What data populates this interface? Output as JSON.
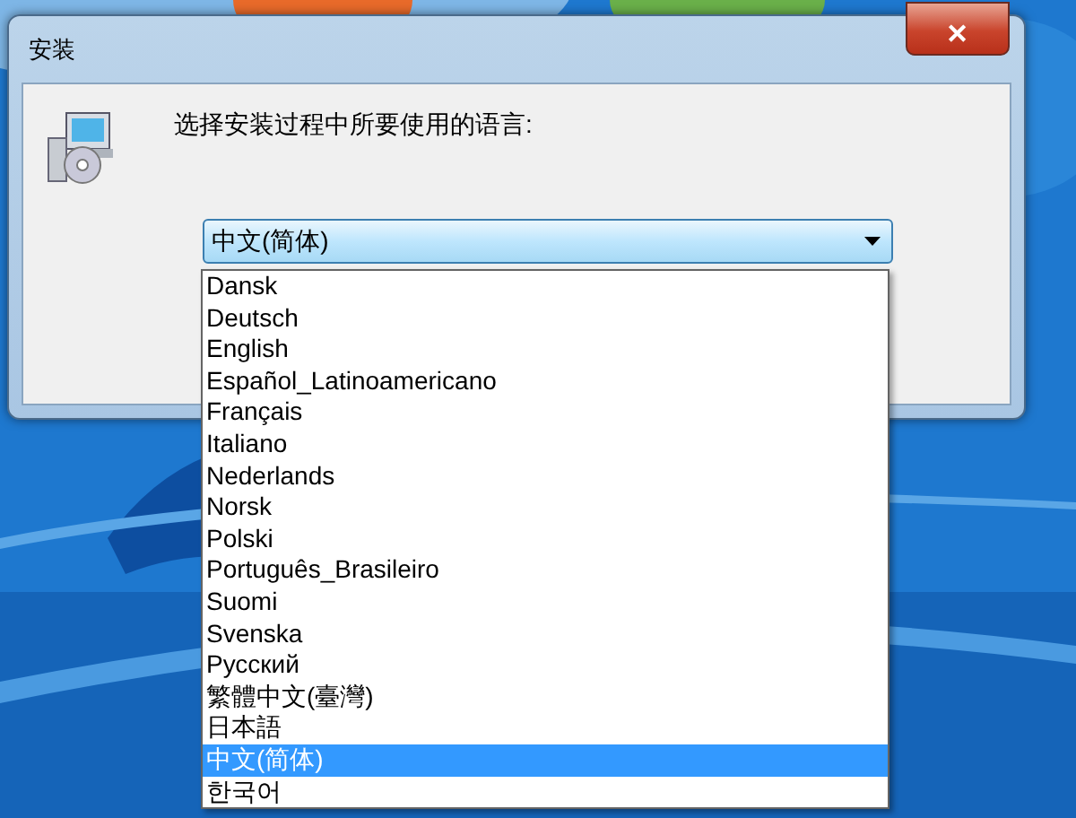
{
  "window": {
    "title": "安装",
    "close": "✕"
  },
  "prompt": "选择安装过程中所要使用的语言:",
  "language_select": {
    "value": "中文(简体)",
    "expanded": true
  },
  "languages": [
    {
      "label": "Dansk",
      "selected": false
    },
    {
      "label": "Deutsch",
      "selected": false
    },
    {
      "label": "English",
      "selected": false
    },
    {
      "label": "Español_Latinoamericano",
      "selected": false
    },
    {
      "label": "Français",
      "selected": false
    },
    {
      "label": "Italiano",
      "selected": false
    },
    {
      "label": "Nederlands",
      "selected": false
    },
    {
      "label": "Norsk",
      "selected": false
    },
    {
      "label": "Polski",
      "selected": false
    },
    {
      "label": "Português_Brasileiro",
      "selected": false
    },
    {
      "label": "Suomi",
      "selected": false
    },
    {
      "label": "Svenska",
      "selected": false
    },
    {
      "label": "Русский",
      "selected": false
    },
    {
      "label": "繁體中文(臺灣)",
      "selected": false
    },
    {
      "label": "日本語",
      "selected": false
    },
    {
      "label": "中文(简体)",
      "selected": true
    },
    {
      "label": "한국어",
      "selected": false
    }
  ]
}
